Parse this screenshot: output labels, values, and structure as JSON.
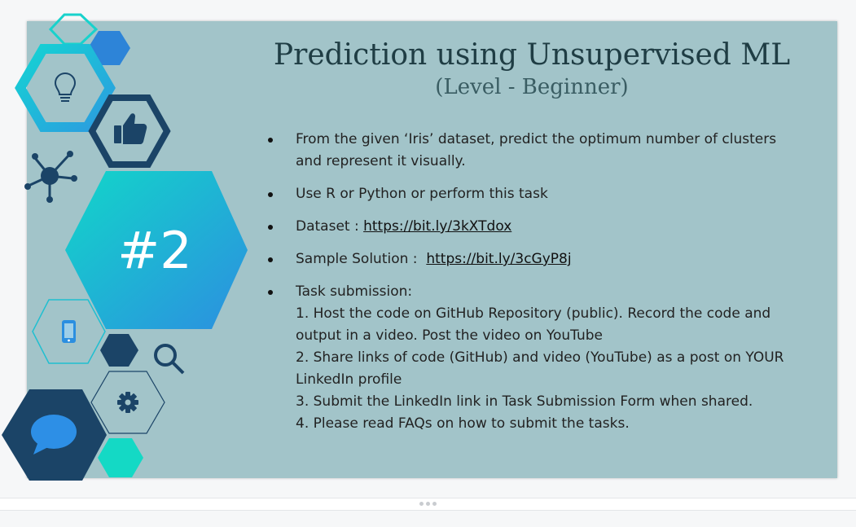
{
  "slide": {
    "title": "Prediction using Unsupervised ML",
    "subtitle": "(Level - Beginner)",
    "badge": "#2",
    "bullets": [
      {
        "text": "From the given ‘Iris’ dataset, predict the optimum number of  clusters and represent it visually."
      },
      {
        "text": "Use R or Python or perform this task"
      },
      {
        "prefix": "Dataset : ",
        "link": "https://bit.ly/3kXTdox"
      },
      {
        "prefix": "Sample Solution :  ",
        "link": "https://bit.ly/3cGyP8j"
      }
    ],
    "submission": {
      "heading": "Task submission:",
      "steps": [
        "1. Host the code on GitHub Repository (public). Record the code and output in a video. Post the video on YouTube",
        "2. Share links of code (GitHub) and video (YouTube) as a post on YOUR LinkedIn profile",
        "3. Submit the LinkedIn link in Task Submission Form when shared.",
        "4. Please read FAQs on how to submit the tasks."
      ]
    },
    "icons": [
      "lightbulb-icon",
      "thumbs-up-icon",
      "network-icon",
      "phone-icon",
      "magnifier-icon",
      "gear-icon",
      "chat-bubble-icon"
    ],
    "colors": {
      "background": "#a2c4c9",
      "navy": "#1b4467",
      "teal": "#12cfc8",
      "blue": "#2f86d8"
    }
  }
}
